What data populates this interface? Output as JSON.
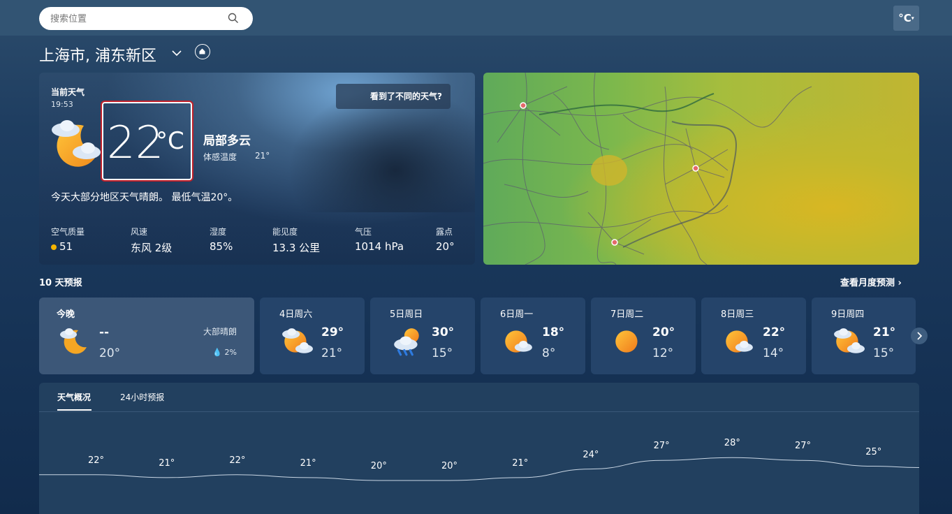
{
  "search": {
    "placeholder": "搜索位置"
  },
  "unit": {
    "label": "°C"
  },
  "location": {
    "name": "上海市, 浦东新区"
  },
  "current": {
    "label": "当前天气",
    "time": "19:53",
    "temp": "22",
    "unit": "°C",
    "condition": "局部多云",
    "feels_label": "体感温度",
    "feels_value": "21°",
    "different_weather": "看到了不同的天气?",
    "summary": "今天大部分地区天气晴朗。 最低气温20°。",
    "stats": [
      {
        "label": "空气质量",
        "value": "51"
      },
      {
        "label": "风速",
        "value": "东风 2级"
      },
      {
        "label": "湿度",
        "value": "85%"
      },
      {
        "label": "能见度",
        "value": "13.3 公里"
      },
      {
        "label": "气压",
        "value": "1014 hPa"
      },
      {
        "label": "露点",
        "value": "20°"
      }
    ],
    "aq_color": "#f5b400"
  },
  "forecast": {
    "title": "10 天预报",
    "monthly_link": "查看月度预测",
    "today": {
      "name": "今晚",
      "hi": "--",
      "lo": "20°",
      "desc": "大部晴朗",
      "precip": "2%"
    },
    "days": [
      {
        "name": "4日周六",
        "hi": "29°",
        "lo": "21°",
        "icon": "partly-cloudy-icon"
      },
      {
        "name": "5日周日",
        "hi": "30°",
        "lo": "15°",
        "icon": "rain-sun-icon"
      },
      {
        "name": "6日周一",
        "hi": "18°",
        "lo": "8°",
        "icon": "mostly-sunny-icon"
      },
      {
        "name": "7日周二",
        "hi": "20°",
        "lo": "12°",
        "icon": "sunny-icon"
      },
      {
        "name": "8日周三",
        "hi": "22°",
        "lo": "14°",
        "icon": "mostly-sunny-icon"
      },
      {
        "name": "9日周四",
        "hi": "21°",
        "lo": "15°",
        "icon": "partly-cloudy-icon"
      }
    ]
  },
  "details": {
    "tabs": [
      "天气概况",
      "24小时预报"
    ],
    "hourly_temps": [
      "22°",
      "21°",
      "22°",
      "21°",
      "20°",
      "20°",
      "21°",
      "24°",
      "27°",
      "28°",
      "27°",
      "25°"
    ]
  }
}
